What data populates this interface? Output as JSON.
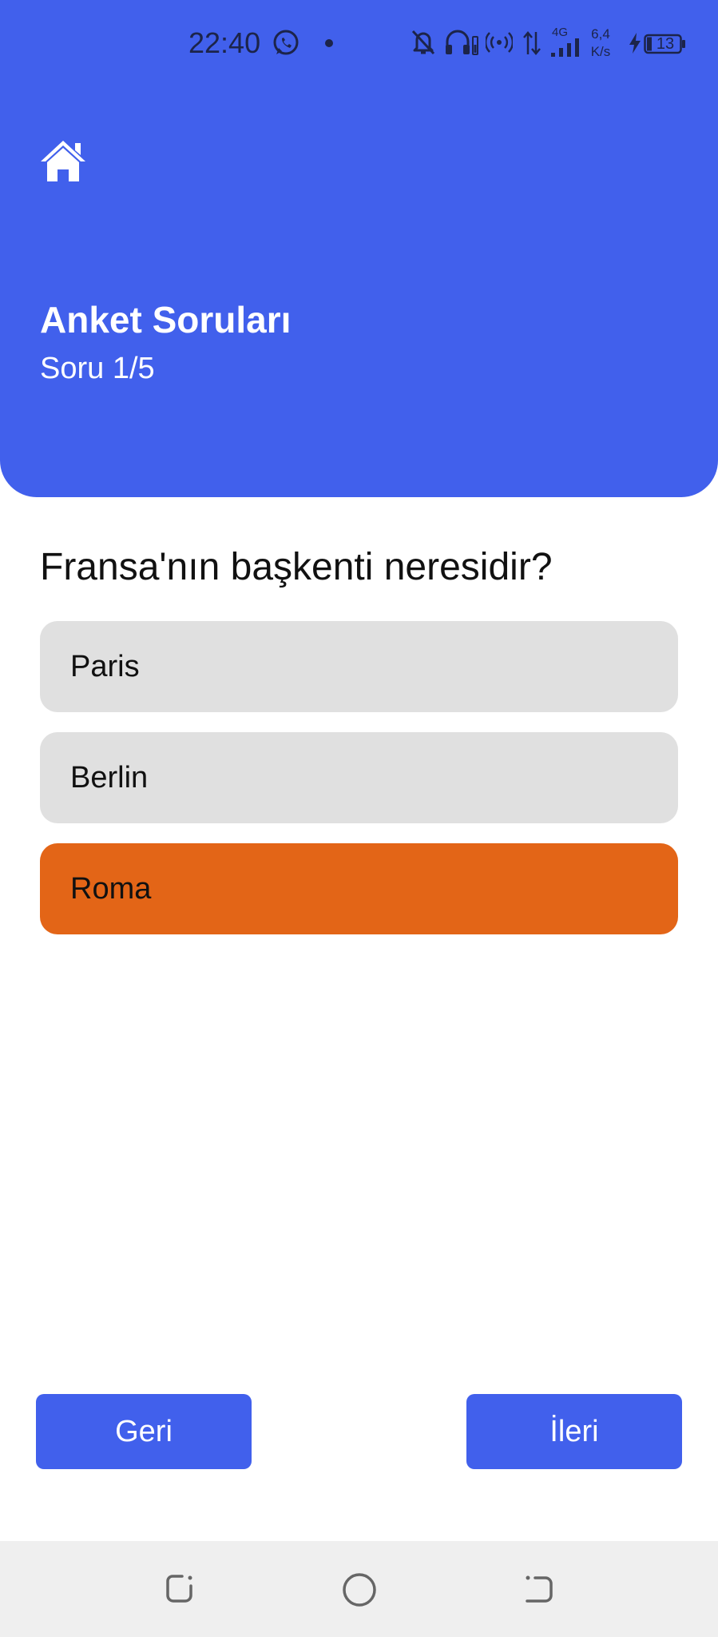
{
  "status_bar": {
    "time": "22:40",
    "network_type": "4G",
    "speed_value": "6,4",
    "speed_unit": "K/s",
    "battery": "13"
  },
  "header": {
    "title": "Anket Soruları",
    "subtitle": "Soru 1/5",
    "background_color": "#4160EC"
  },
  "question": {
    "text": "Fransa'nın başkenti neresidir?",
    "options": [
      {
        "label": "Paris",
        "selected": false
      },
      {
        "label": "Berlin",
        "selected": false
      },
      {
        "label": "Roma",
        "selected": true
      }
    ],
    "option_color": "#E0E0E0",
    "selected_color": "#E36517"
  },
  "navigation": {
    "back_label": "Geri",
    "next_label": "İleri"
  }
}
